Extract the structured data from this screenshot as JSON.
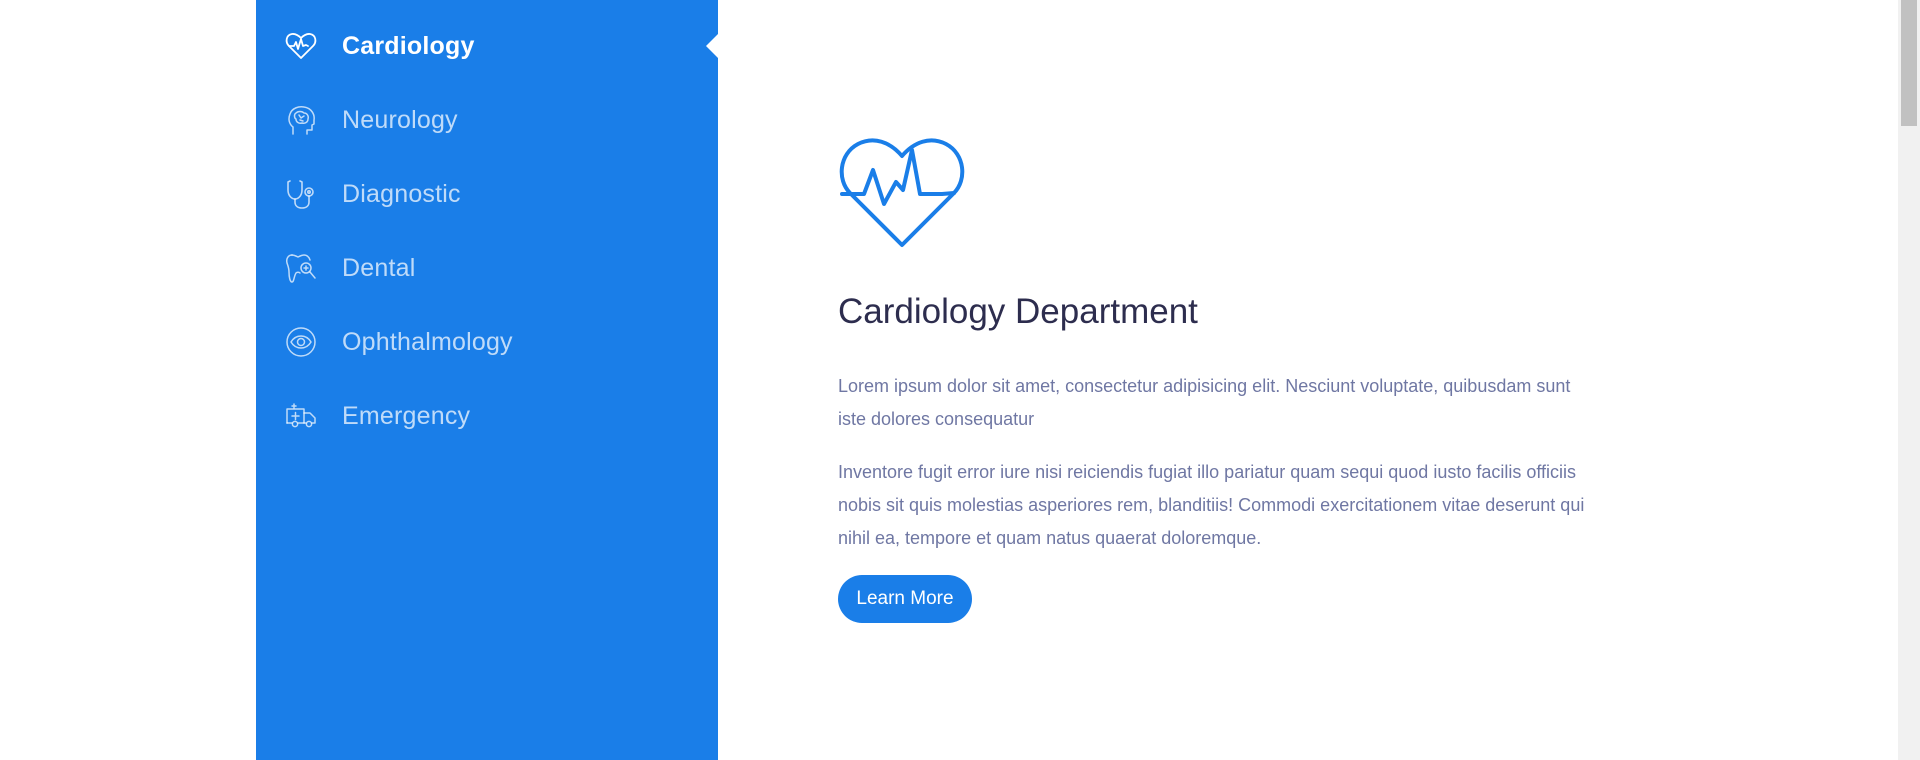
{
  "sidebar": {
    "tabs": [
      {
        "label": "Cardiology",
        "icon": "heart-pulse-icon",
        "active": true
      },
      {
        "label": "Neurology",
        "icon": "brain-head-icon",
        "active": false
      },
      {
        "label": "Diagnostic",
        "icon": "stethoscope-icon",
        "active": false
      },
      {
        "label": "Dental",
        "icon": "tooth-icon",
        "active": false
      },
      {
        "label": "Ophthalmology",
        "icon": "eye-icon",
        "active": false
      },
      {
        "label": "Emergency",
        "icon": "ambulance-icon",
        "active": false
      }
    ]
  },
  "content": {
    "icon": "heart-pulse-icon",
    "title": "Cardiology Department",
    "paragraph1": "Lorem ipsum dolor sit amet, consectetur adipisicing elit. Nesciunt voluptate, quibusdam sunt iste dolores consequatur",
    "paragraph2": "Inventore fugit error iure nisi reiciendis fugiat illo pariatur quam sequi quod iusto facilis officiis nobis sit quis molestias asperiores rem, blanditiis! Commodi exercitationem vitae deserunt qui nihil ea, tempore et quam natus quaerat doloremque.",
    "button_label": "Learn More"
  },
  "colors": {
    "accent": "#1a7ee8",
    "title": "#2d2d4e",
    "body_text": "#6f77a3"
  }
}
